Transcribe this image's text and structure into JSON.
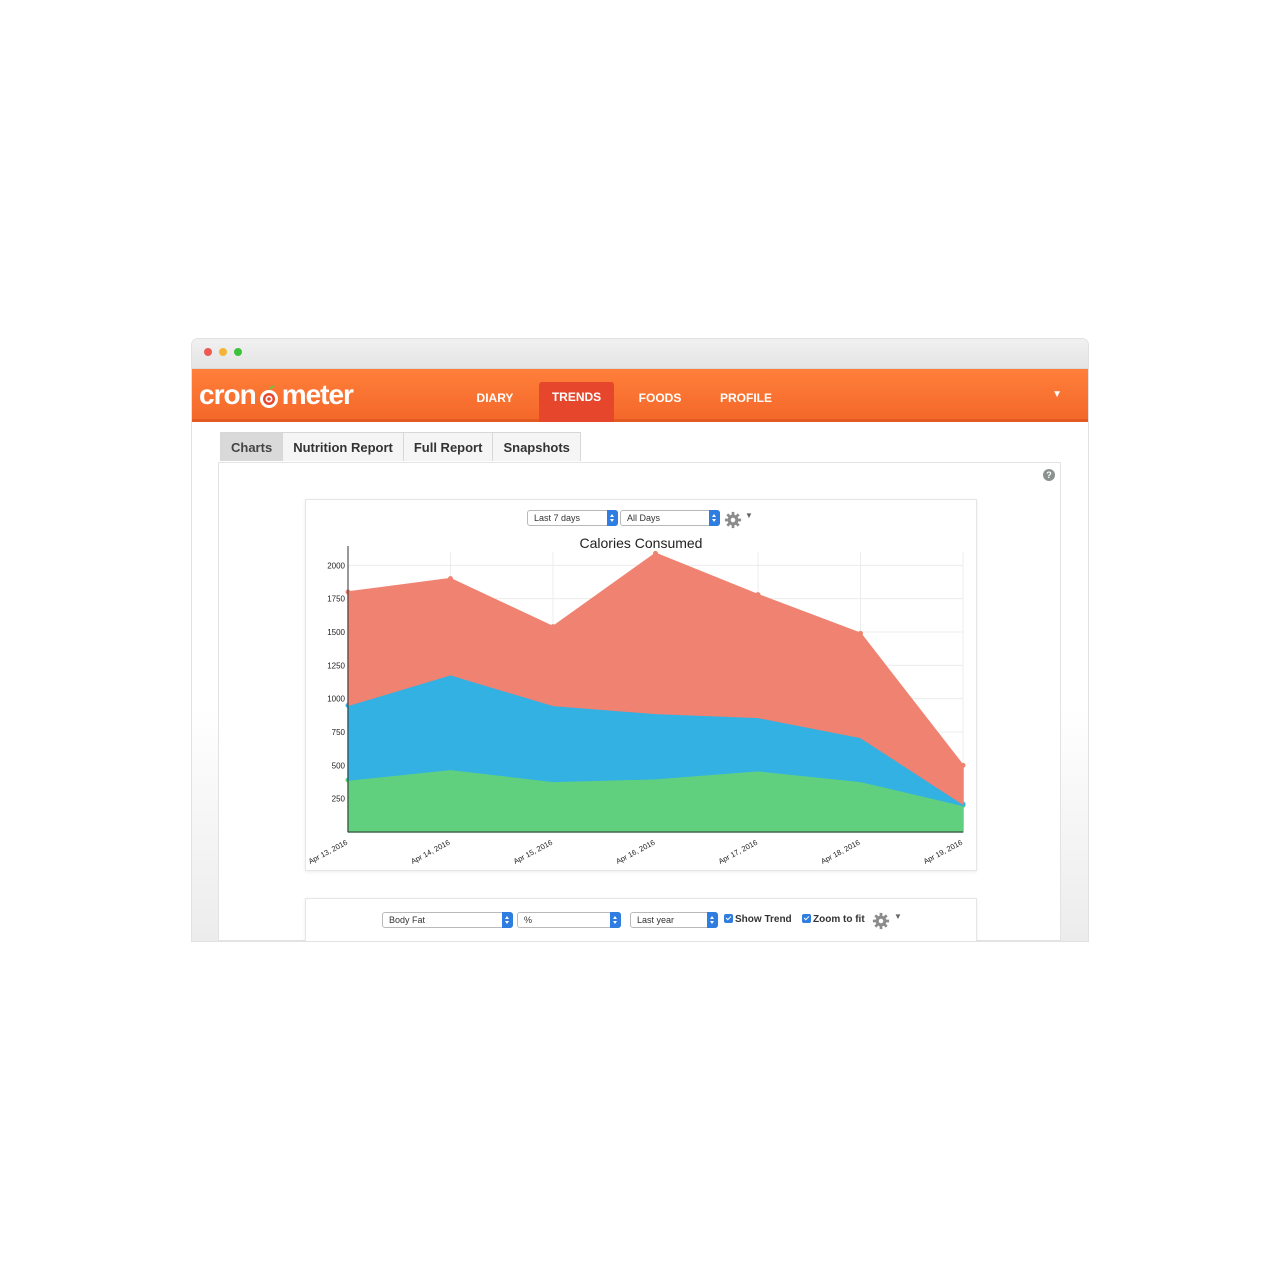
{
  "app": {
    "logo_text_left": "cron",
    "logo_text_right": "meter"
  },
  "nav": {
    "items": [
      {
        "label": "DIARY",
        "active": false
      },
      {
        "label": "TRENDS",
        "active": true
      },
      {
        "label": "FOODS",
        "active": false
      },
      {
        "label": "PROFILE",
        "active": false
      }
    ],
    "caret": "▼"
  },
  "tabs": [
    {
      "label": "Charts",
      "active": true
    },
    {
      "label": "Nutrition Report",
      "active": false
    },
    {
      "label": "Full Report",
      "active": false
    },
    {
      "label": "Snapshots",
      "active": false
    }
  ],
  "help_icon": "?",
  "chart1_controls": {
    "range": "Last 7 days",
    "days": "All Days"
  },
  "chart2_controls": {
    "metric": "Body Fat",
    "unit": "%",
    "range": "Last year",
    "show_trend_label": "Show Trend",
    "show_trend_checked": true,
    "zoom_label": "Zoom to fit",
    "zoom_checked": true
  },
  "colors": {
    "brand_orange": "#f4682a",
    "active_tab_red": "#e6462b",
    "series_top": "#ef8271",
    "series_mid": "#33b1e3",
    "series_bottom": "#61d07e"
  },
  "chart_data": {
    "type": "area",
    "stacked": true,
    "title": "Calories Consumed",
    "x": [
      "Apr 13, 2016",
      "Apr 14, 2016",
      "Apr 15, 2016",
      "Apr 16, 2016",
      "Apr 17, 2016",
      "Apr 18, 2016",
      "Apr 19, 2016"
    ],
    "series": [
      {
        "values": [
          390,
          470,
          380,
          400,
          460,
          380,
          200
        ],
        "color": "#61d07e"
      },
      {
        "values": [
          560,
          710,
          570,
          490,
          400,
          330,
          10
        ],
        "color": "#33b1e3"
      },
      {
        "values": [
          850,
          720,
          590,
          1200,
          920,
          780,
          290
        ],
        "color": "#ef8271"
      }
    ],
    "yticks": [
      250,
      500,
      750,
      1000,
      1250,
      1500,
      1750,
      2000
    ],
    "ylim": [
      0,
      2100
    ],
    "grid": true
  }
}
